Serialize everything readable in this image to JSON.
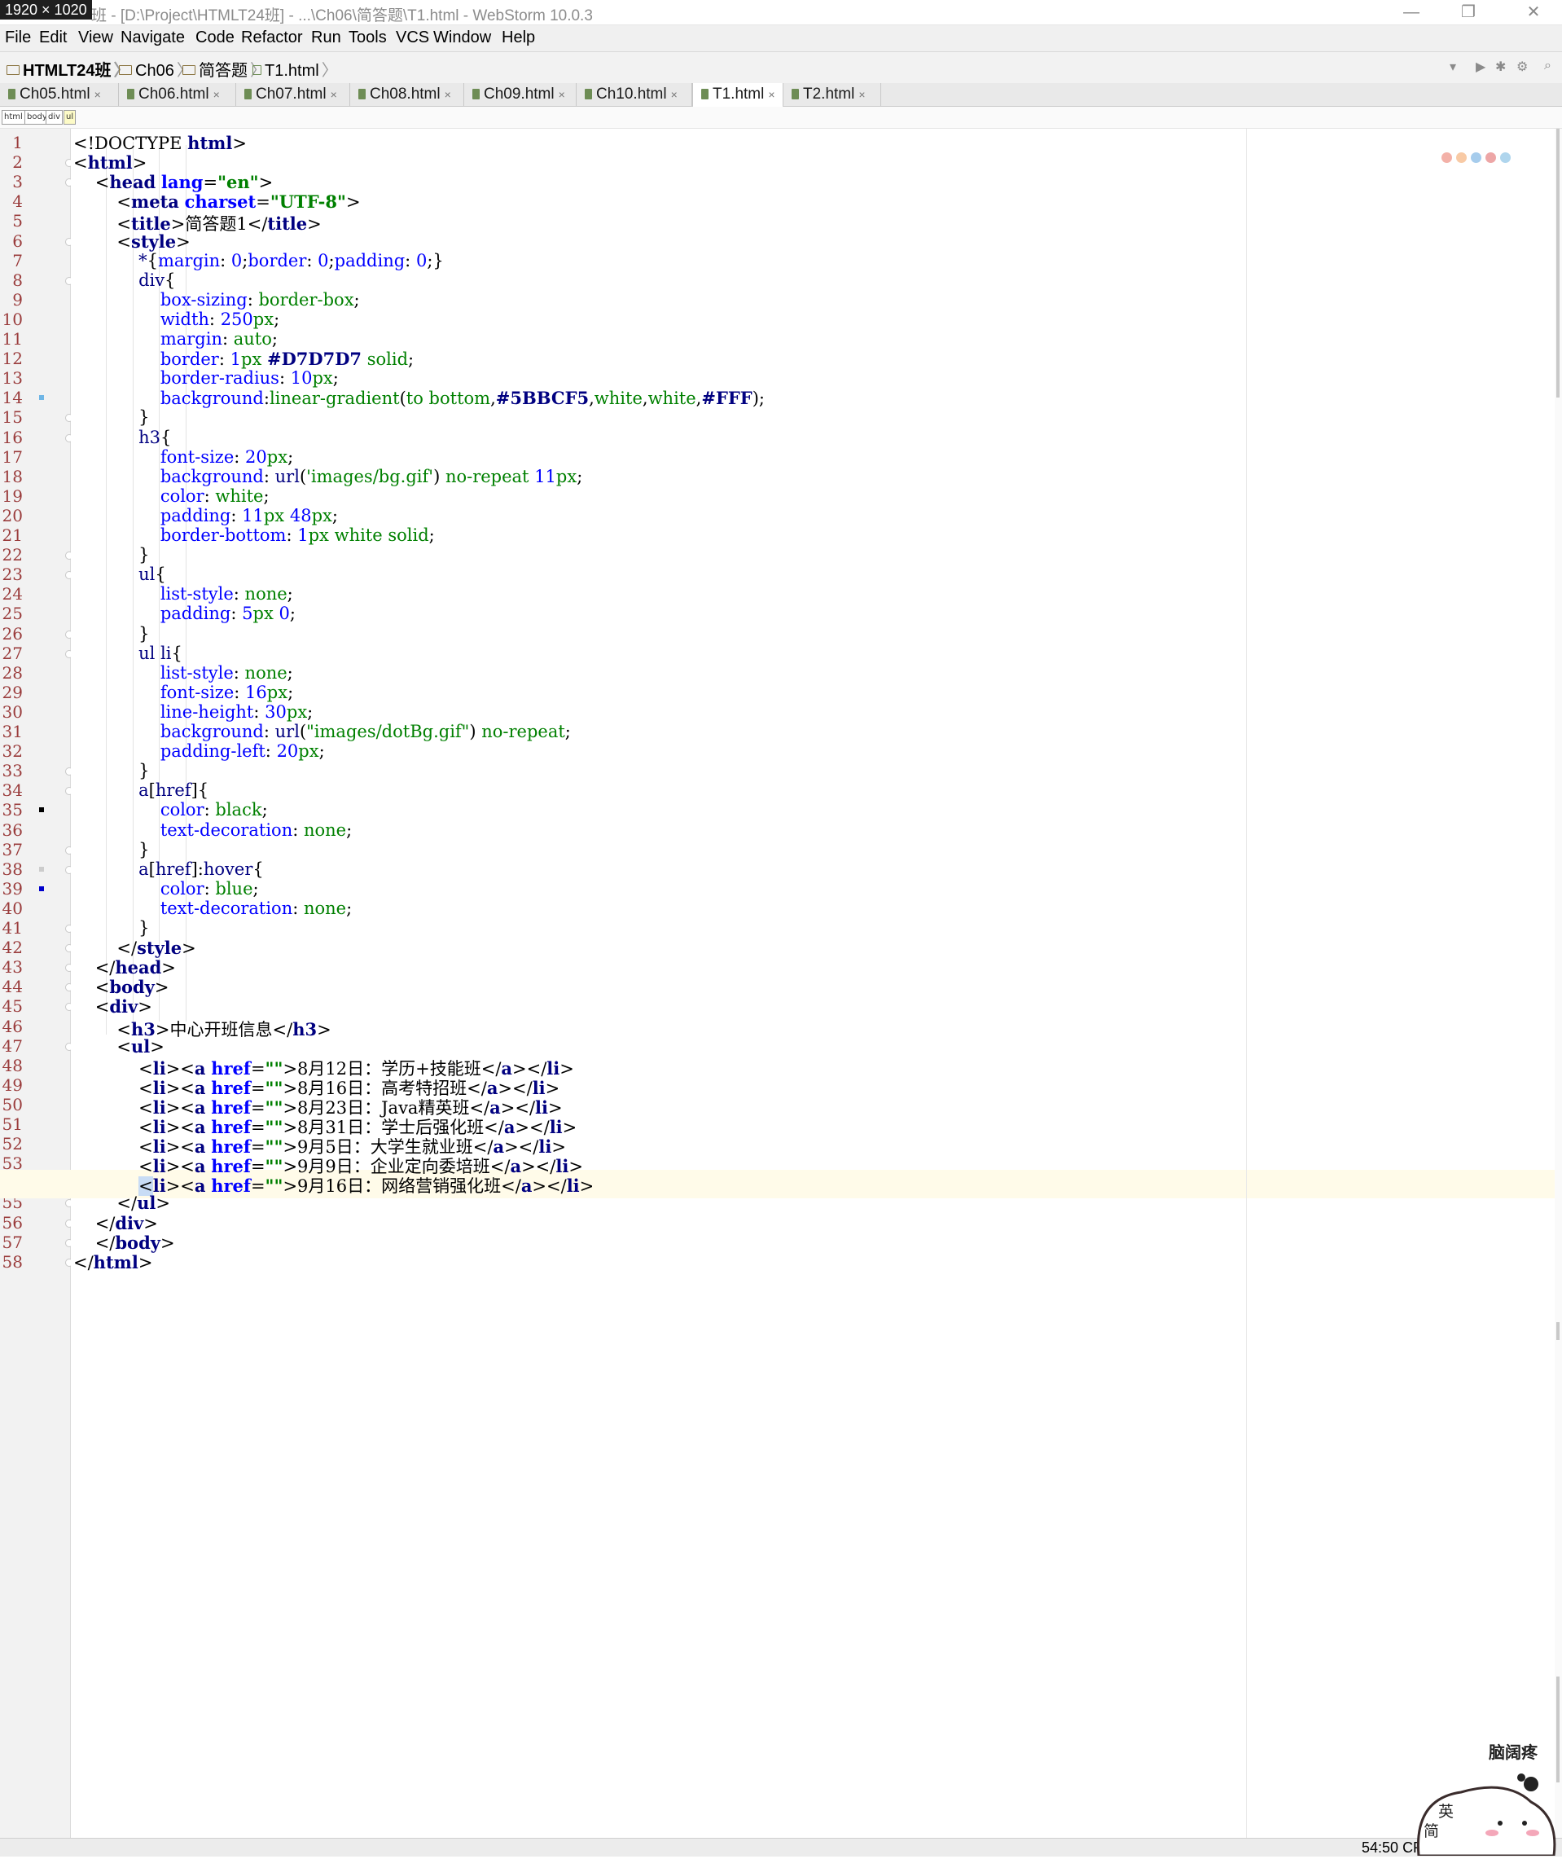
{
  "screenshot_badge": "1920 × 1020",
  "window": {
    "title": "班 - [D:\\Project\\HTMLT24班] - ...\\Ch06\\简答题\\T1.html - WebStorm 10.0.3",
    "minimize": "—",
    "restore": "❐",
    "close": "✕"
  },
  "menu": [
    "File",
    "Edit",
    "View",
    "Navigate",
    "Code",
    "Refactor",
    "Run",
    "Tools",
    "VCS",
    "Window",
    "Help"
  ],
  "breadcrumb": [
    "HTMLT24班",
    "Ch06",
    "简答题",
    "T1.html"
  ],
  "tabs": [
    {
      "label": "Ch05.html",
      "active": false
    },
    {
      "label": "Ch06.html",
      "active": false
    },
    {
      "label": "Ch07.html",
      "active": false
    },
    {
      "label": "Ch08.html",
      "active": false
    },
    {
      "label": "Ch09.html",
      "active": false
    },
    {
      "label": "Ch10.html",
      "active": false
    },
    {
      "label": "T1.html",
      "active": true
    },
    {
      "label": "T2.html",
      "active": false
    }
  ],
  "tab_close": "×",
  "structure": [
    "html",
    "body",
    "div",
    "ul"
  ],
  "code_lines": [
    "<!DOCTYPE html>",
    "<html>",
    "    <head lang=\"en\">",
    "        <meta charset=\"UTF-8\">",
    "        <title>简答题1</title>",
    "        <style>",
    "            *{margin: 0;border: 0;padding: 0;}",
    "            div{",
    "                box-sizing: border-box;",
    "                width: 250px;",
    "                margin: auto;",
    "                border: 1px #D7D7D7 solid;",
    "                border-radius: 10px;",
    "                background:linear-gradient(to bottom,#5BBCF5,white,white,#FFF);",
    "            }",
    "            h3{",
    "                font-size: 20px;",
    "                background: url('images/bg.gif') no-repeat 11px;",
    "                color: white;",
    "                padding: 11px 48px;",
    "                border-bottom: 1px white solid;",
    "            }",
    "            ul{",
    "                list-style: none;",
    "                padding: 5px 0;",
    "            }",
    "            ul li{",
    "                list-style: none;",
    "                font-size: 16px;",
    "                line-height: 30px;",
    "                background: url(\"images/dotBg.gif\") no-repeat;",
    "                padding-left: 20px;",
    "            }",
    "            a[href]{",
    "                color: black;",
    "                text-decoration: none;",
    "            }",
    "            a[href]:hover{",
    "                color: blue;",
    "                text-decoration: none;",
    "            }",
    "        </style>",
    "    </head>",
    "    <body>",
    "    <div>",
    "        <h3>中心开班信息</h3>",
    "        <ul>",
    "            <li><a href=\"\">8月12日：学历+技能班</a></li>",
    "            <li><a href=\"\">8月16日：高考特招班</a></li>",
    "            <li><a href=\"\">8月23日：Java精英班</a></li>",
    "            <li><a href=\"\">8月31日：学士后强化班</a></li>",
    "            <li><a href=\"\">9月5日：大学生就业班</a></li>",
    "            <li><a href=\"\">9月9日：企业定向委培班</a></li>",
    "            <li><a href=\"\">9月16日：网络营销强化班</a></li>",
    "        </ul>",
    "    </div>",
    "    </body>",
    "</html>"
  ],
  "caret_line": 54,
  "status": {
    "position": "54:50",
    "extra": "CR"
  },
  "mascot": {
    "title": "脑阔疼",
    "key1": "英",
    "key2": "简"
  },
  "colors": {
    "tag": "#000080",
    "attr": "#0000ff",
    "value": "#008000",
    "line_number": "#9a3c3c",
    "caret_row": "#fffbe9"
  }
}
